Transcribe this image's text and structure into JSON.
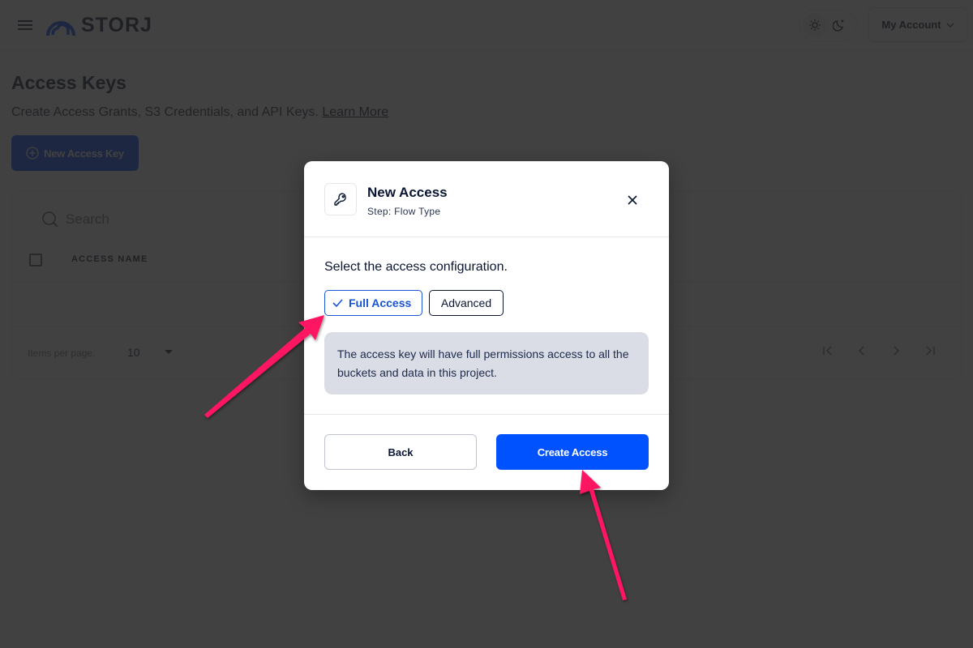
{
  "header": {
    "logo_text": "STORJ",
    "account_label": "My Account",
    "theme": {
      "light_icon": "sun-icon",
      "dark_icon": "moon-icon",
      "active": "light"
    }
  },
  "page": {
    "title": "Access Keys",
    "subtitle": "Create Access Grants, S3 Credentials, and API Keys.",
    "learn_more": "Learn More",
    "new_key_label": "New Access Key"
  },
  "table": {
    "search_placeholder": "Search",
    "columns": [
      "ACCESS NAME"
    ],
    "rows": [],
    "items_per_page_label": "Items per page:",
    "items_per_page_value": "10",
    "pager_icons": [
      "first-page-icon",
      "prev-page-icon",
      "next-page-icon",
      "last-page-icon"
    ]
  },
  "modal": {
    "title": "New Access",
    "step": "Step: Flow Type",
    "prompt": "Select the access configuration.",
    "options": [
      {
        "label": "Full Access",
        "selected": true
      },
      {
        "label": "Advanced",
        "selected": false
      }
    ],
    "info": "The access key will have full permissions access to all the buckets and data in this project.",
    "back_label": "Back",
    "create_label": "Create Access"
  },
  "colors": {
    "brand_blue": "#0052ff",
    "logo_blue": "#0149ff",
    "selected_chip": "#1754d6",
    "annotation_arrow": "#ff1463",
    "text_dark": "#0a1633"
  }
}
